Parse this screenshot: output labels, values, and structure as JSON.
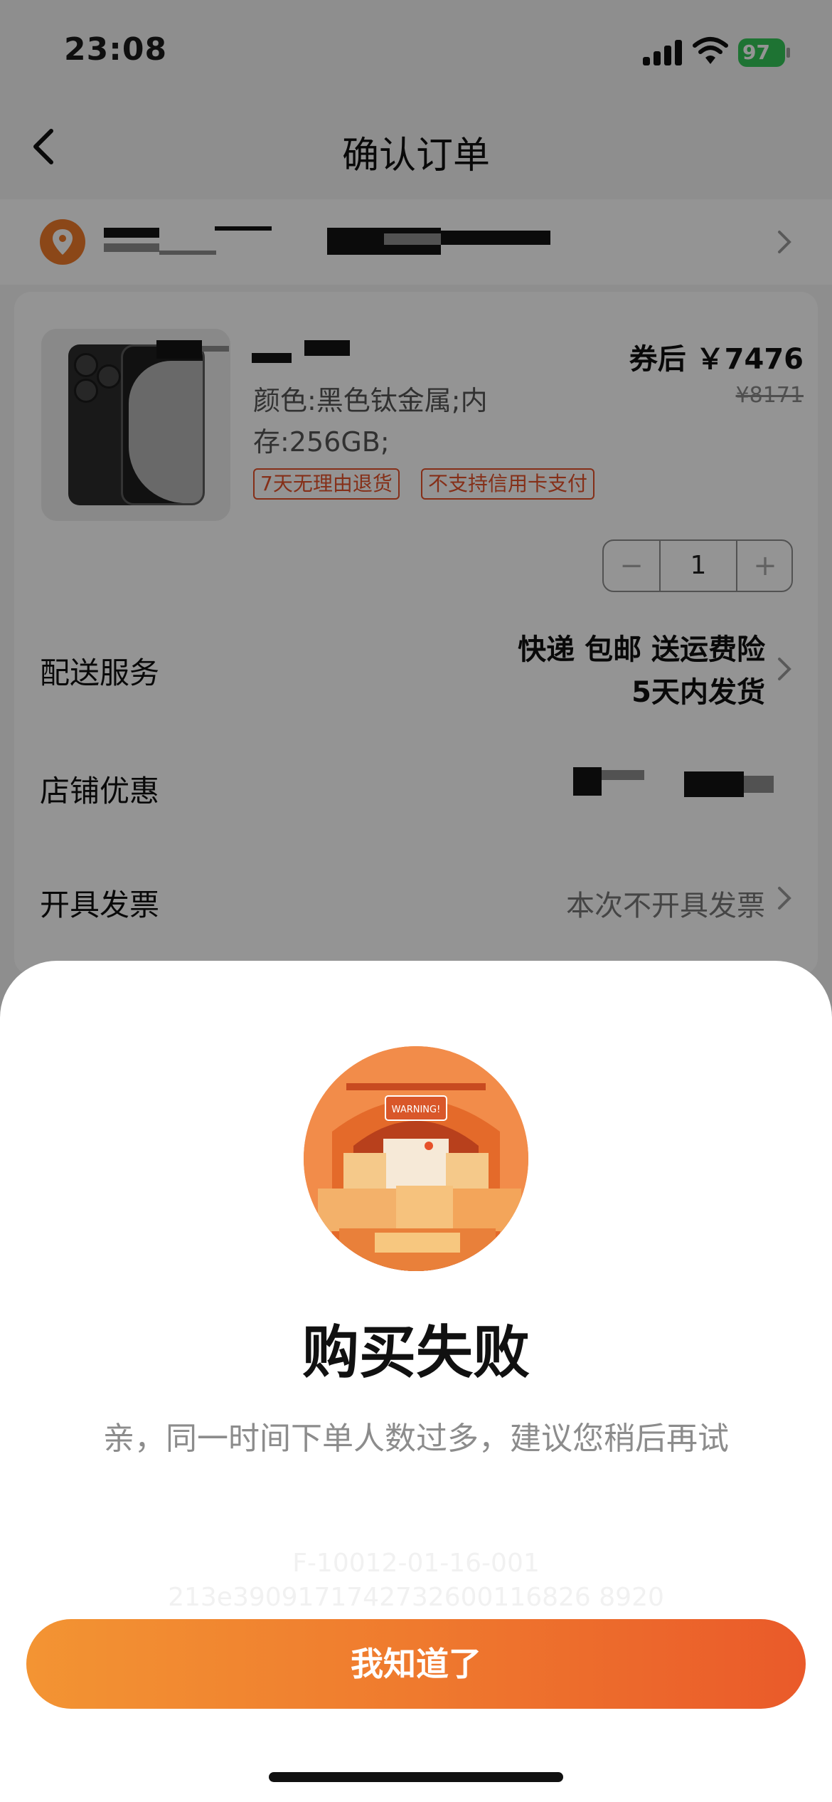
{
  "status_bar": {
    "time": "23:08",
    "battery": "97"
  },
  "nav": {
    "title": "确认订单"
  },
  "product": {
    "price": "券后 ￥7476",
    "original_price": "¥8171",
    "spec_line1": "颜色:黑色钛金属;内",
    "spec_line2": "存:256GB;",
    "tags": [
      "7天无理由退货",
      "不支持信用卡支付"
    ],
    "quantity": "1",
    "minus_symbol": "−",
    "plus_symbol": "+"
  },
  "rows": {
    "delivery_label": "配送服务",
    "delivery_value_line1": "快递 包邮 送运费险",
    "delivery_value_line2": "5天内发货",
    "shop_discount_label": "店铺优惠",
    "invoice_label": "开具发票",
    "invoice_value": "本次不开具发票"
  },
  "sheet": {
    "warning_sign": "WARNING!",
    "title": "购买失败",
    "message": "亲，同一时间下单人数过多，建议您稍后再试",
    "error_code": "F-10012-01-16-001",
    "trace_id": "213e3909171742732600116826 8920",
    "ok_button": "我知道了"
  },
  "colors": {
    "accent": "#ef7a2e",
    "tag": "#e6512a",
    "battery": "#34c759"
  },
  "icons": [
    "back-icon",
    "location-icon",
    "chevron-right-icon",
    "signal-icon",
    "wifi-icon",
    "battery-icon"
  ]
}
